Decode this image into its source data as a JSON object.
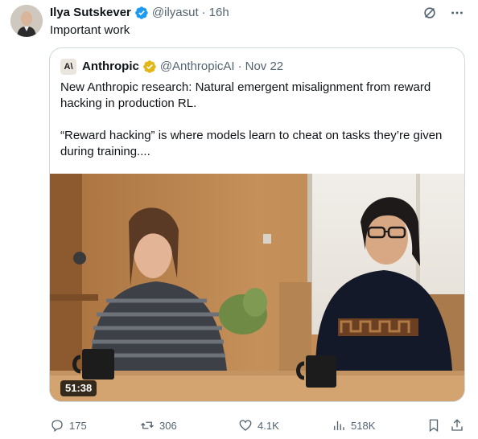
{
  "tweet": {
    "author_name": "Ilya Sutskever",
    "author_handle": "@ilyasut",
    "separator": "·",
    "time": "16h",
    "text": "Important work"
  },
  "quote": {
    "logo_text": "A\\",
    "author_name": "Anthropic",
    "author_handle": "@AnthropicAI",
    "separator": "·",
    "date": "Nov 22",
    "text": "New Anthropic research: Natural emergent misalignment from reward hacking in production RL.\n\n“Reward hacking” is where models learn to cheat on tasks they’re given during training....",
    "video_duration": "51:38"
  },
  "actions": {
    "replies": "175",
    "reposts": "306",
    "likes": "4.1K",
    "views": "518K"
  },
  "colors": {
    "text_primary": "#0f1419",
    "text_secondary": "#536471",
    "verified_blue": "#1d9bf0",
    "verified_gold": "#e2b719",
    "border": "#cfd9de"
  },
  "icons": [
    "verified-badge-icon",
    "grok-icon",
    "more-icon",
    "reply-icon",
    "repost-icon",
    "like-icon",
    "views-icon",
    "bookmark-icon",
    "share-icon"
  ]
}
